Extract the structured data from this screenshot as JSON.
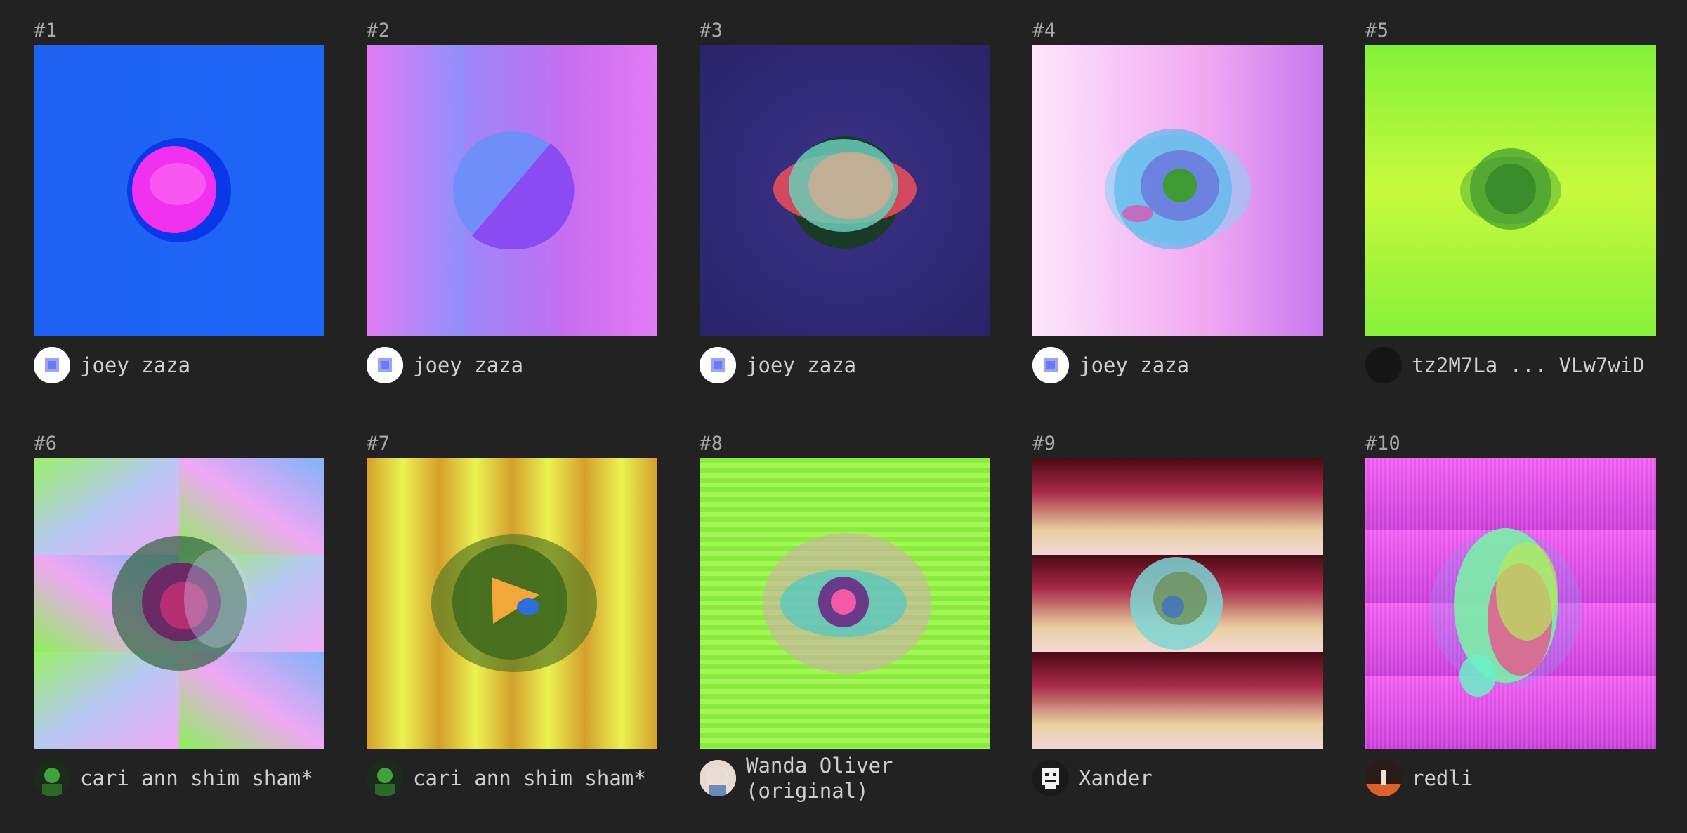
{
  "items": [
    {
      "rank": "#1",
      "owner": "joey zaza"
    },
    {
      "rank": "#2",
      "owner": "joey zaza"
    },
    {
      "rank": "#3",
      "owner": "joey zaza"
    },
    {
      "rank": "#4",
      "owner": "joey zaza"
    },
    {
      "rank": "#5",
      "owner": "tz2M7La ... VLw7wiD"
    },
    {
      "rank": "#6",
      "owner": "cari ann shim sham*"
    },
    {
      "rank": "#7",
      "owner": "cari ann shim sham*"
    },
    {
      "rank": "#8",
      "owner": "Wanda Oliver\n(original)"
    },
    {
      "rank": "#9",
      "owner": "Xander"
    },
    {
      "rank": "#10",
      "owner": "redli"
    }
  ]
}
